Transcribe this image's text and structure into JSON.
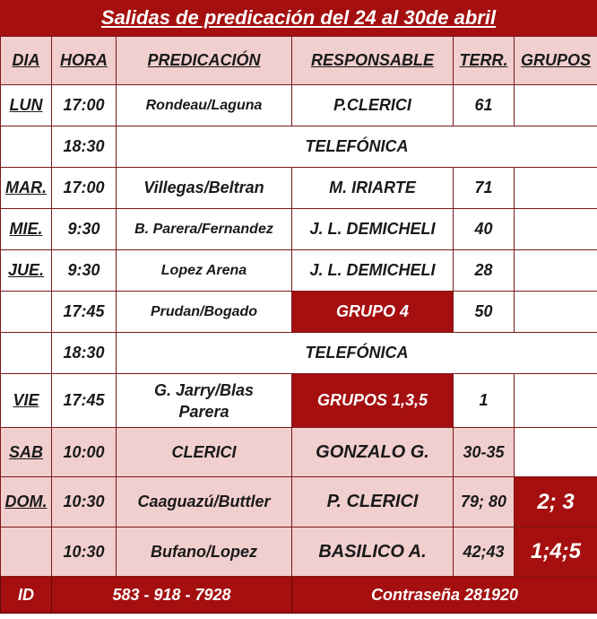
{
  "title": "Salidas de predicación del 24 al 30de abril",
  "headers": {
    "dia": "DIA",
    "hora": "HORA",
    "predicacion": "PREDICACIÓN",
    "responsable": "RESPONSABLE",
    "terr": "TERR.",
    "grupos": "GRUPOS"
  },
  "rows": [
    {
      "dia": "LUN",
      "hora": "17:00",
      "predicacion": "Rondeau/Laguna",
      "responsable": "P.CLERICI",
      "terr": "61",
      "grupos": ""
    },
    {
      "dia": "",
      "hora": "18:30",
      "predicacion": "TELEFÓNICA"
    },
    {
      "dia": "MAR.",
      "hora": "17:00",
      "predicacion": "Villegas/Beltran",
      "responsable": "M. IRIARTE",
      "terr": "71",
      "grupos": ""
    },
    {
      "dia": "MIE.",
      "hora": "9:30",
      "predicacion": "B. Parera/Fernandez",
      "responsable": "J. L. DEMICHELI",
      "terr": "40",
      "grupos": ""
    },
    {
      "dia": "JUE.",
      "hora": "9:30",
      "predicacion": "Lopez Arena",
      "responsable": "J. L. DEMICHELI",
      "terr": "28",
      "grupos": ""
    },
    {
      "dia": "",
      "hora": "17:45",
      "predicacion": "Prudan/Bogado",
      "responsable": "GRUPO 4",
      "terr": "50",
      "grupos": ""
    },
    {
      "dia": "",
      "hora": "18:30",
      "predicacion": "TELEFÓNICA"
    },
    {
      "dia": "VIE",
      "hora": "17:45",
      "predicacion": "G. Jarry/Blas Parera",
      "responsable": "GRUPOS 1,3,5",
      "terr": "1",
      "grupos": ""
    },
    {
      "dia": "SAB",
      "hora": "10:00",
      "predicacion": "CLERICI",
      "responsable": "GONZALO G.",
      "terr": "30-35",
      "grupos": ""
    },
    {
      "dia": "DOM.",
      "hora": "10:30",
      "predicacion": "Caaguazú/Buttler",
      "responsable": "P. CLERICI",
      "terr": "79; 80",
      "grupos": "2; 3"
    },
    {
      "dia": "",
      "hora": "10:30",
      "predicacion": "Bufano/Lopez",
      "responsable": "BASILICO A.",
      "terr": "42;43",
      "grupos": "1;4;5"
    }
  ],
  "footer": {
    "id_label": "ID",
    "id_value": "583 - 918 - 7928",
    "password": "Contraseña 281920"
  },
  "colors": {
    "accent_red": "#a50f0f",
    "light_pink": "#f2cfcf",
    "border": "#7a1818"
  }
}
